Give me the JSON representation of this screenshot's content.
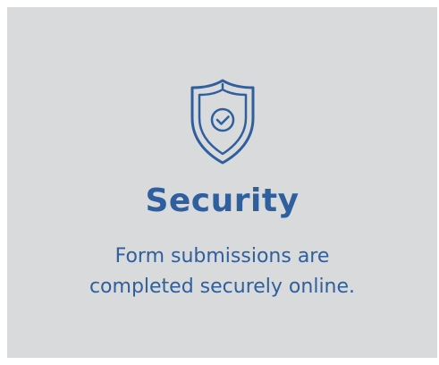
{
  "card": {
    "icon": "shield-check-icon",
    "title": "Security",
    "description_lines": [
      "Form submissions are",
      "completed securely online."
    ]
  },
  "colors": {
    "background": "#d9dadb",
    "accent": "#2f5f9e"
  }
}
